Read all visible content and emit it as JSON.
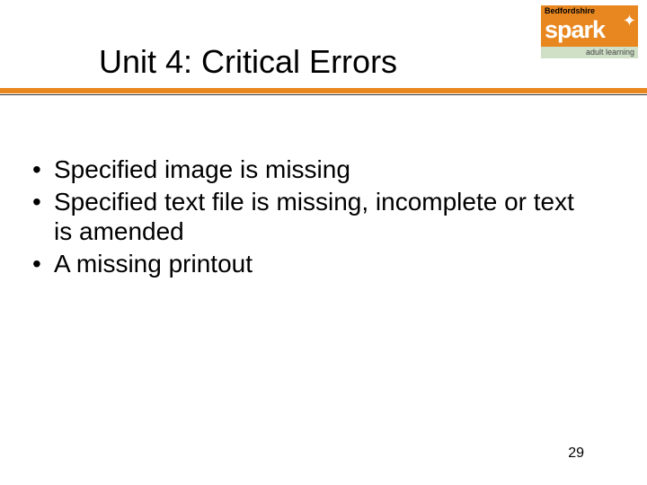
{
  "logo": {
    "top": "Bedfordshire",
    "brand": "spark",
    "bottom": "adult learning"
  },
  "title": "Unit 4: Critical Errors",
  "bullets": [
    "Specified image is missing",
    "Specified text file is missing, incomplete or text is amended",
    "A missing printout"
  ],
  "page_number": "29"
}
